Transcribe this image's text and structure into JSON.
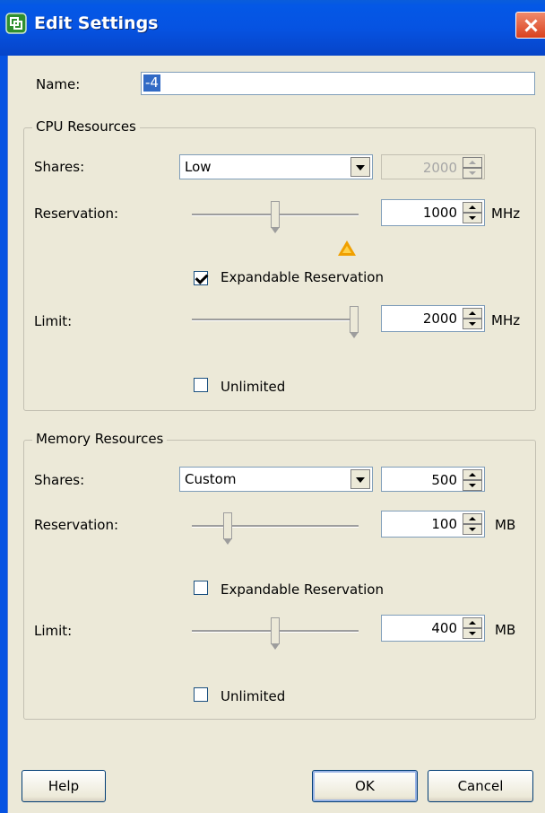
{
  "window": {
    "title": "Edit Settings"
  },
  "name": {
    "label": "Name:",
    "value": "-4"
  },
  "cpu": {
    "legend": "CPU Resources",
    "shares_label": "Shares:",
    "shares_value": "Low",
    "shares_number": "2000",
    "reservation_label": "Reservation:",
    "reservation_value": "1000",
    "reservation_unit": "MHz",
    "reservation_slider_fraction": 0.5,
    "expandable_label": "Expandable Reservation",
    "expandable_checked": true,
    "limit_label": "Limit:",
    "limit_value": "2000",
    "limit_unit": "MHz",
    "limit_slider_fraction": 1.0,
    "unlimited_label": "Unlimited",
    "unlimited_checked": false,
    "warning_icon": "warning-triangle-icon"
  },
  "memory": {
    "legend": "Memory Resources",
    "shares_label": "Shares:",
    "shares_value": "Custom",
    "shares_number": "500",
    "reservation_label": "Reservation:",
    "reservation_value": "100",
    "reservation_unit": "MB",
    "reservation_slider_fraction": 0.2,
    "expandable_label": "Expandable Reservation",
    "expandable_checked": false,
    "limit_label": "Limit:",
    "limit_value": "400",
    "limit_unit": "MB",
    "limit_slider_fraction": 0.5,
    "unlimited_label": "Unlimited",
    "unlimited_checked": false
  },
  "buttons": {
    "help": "Help",
    "ok": "OK",
    "cancel": "Cancel"
  },
  "colors": {
    "titlebar": "#0653e2",
    "client": "#ece9d8",
    "close": "#d9411f",
    "warning": "#f0a000"
  }
}
